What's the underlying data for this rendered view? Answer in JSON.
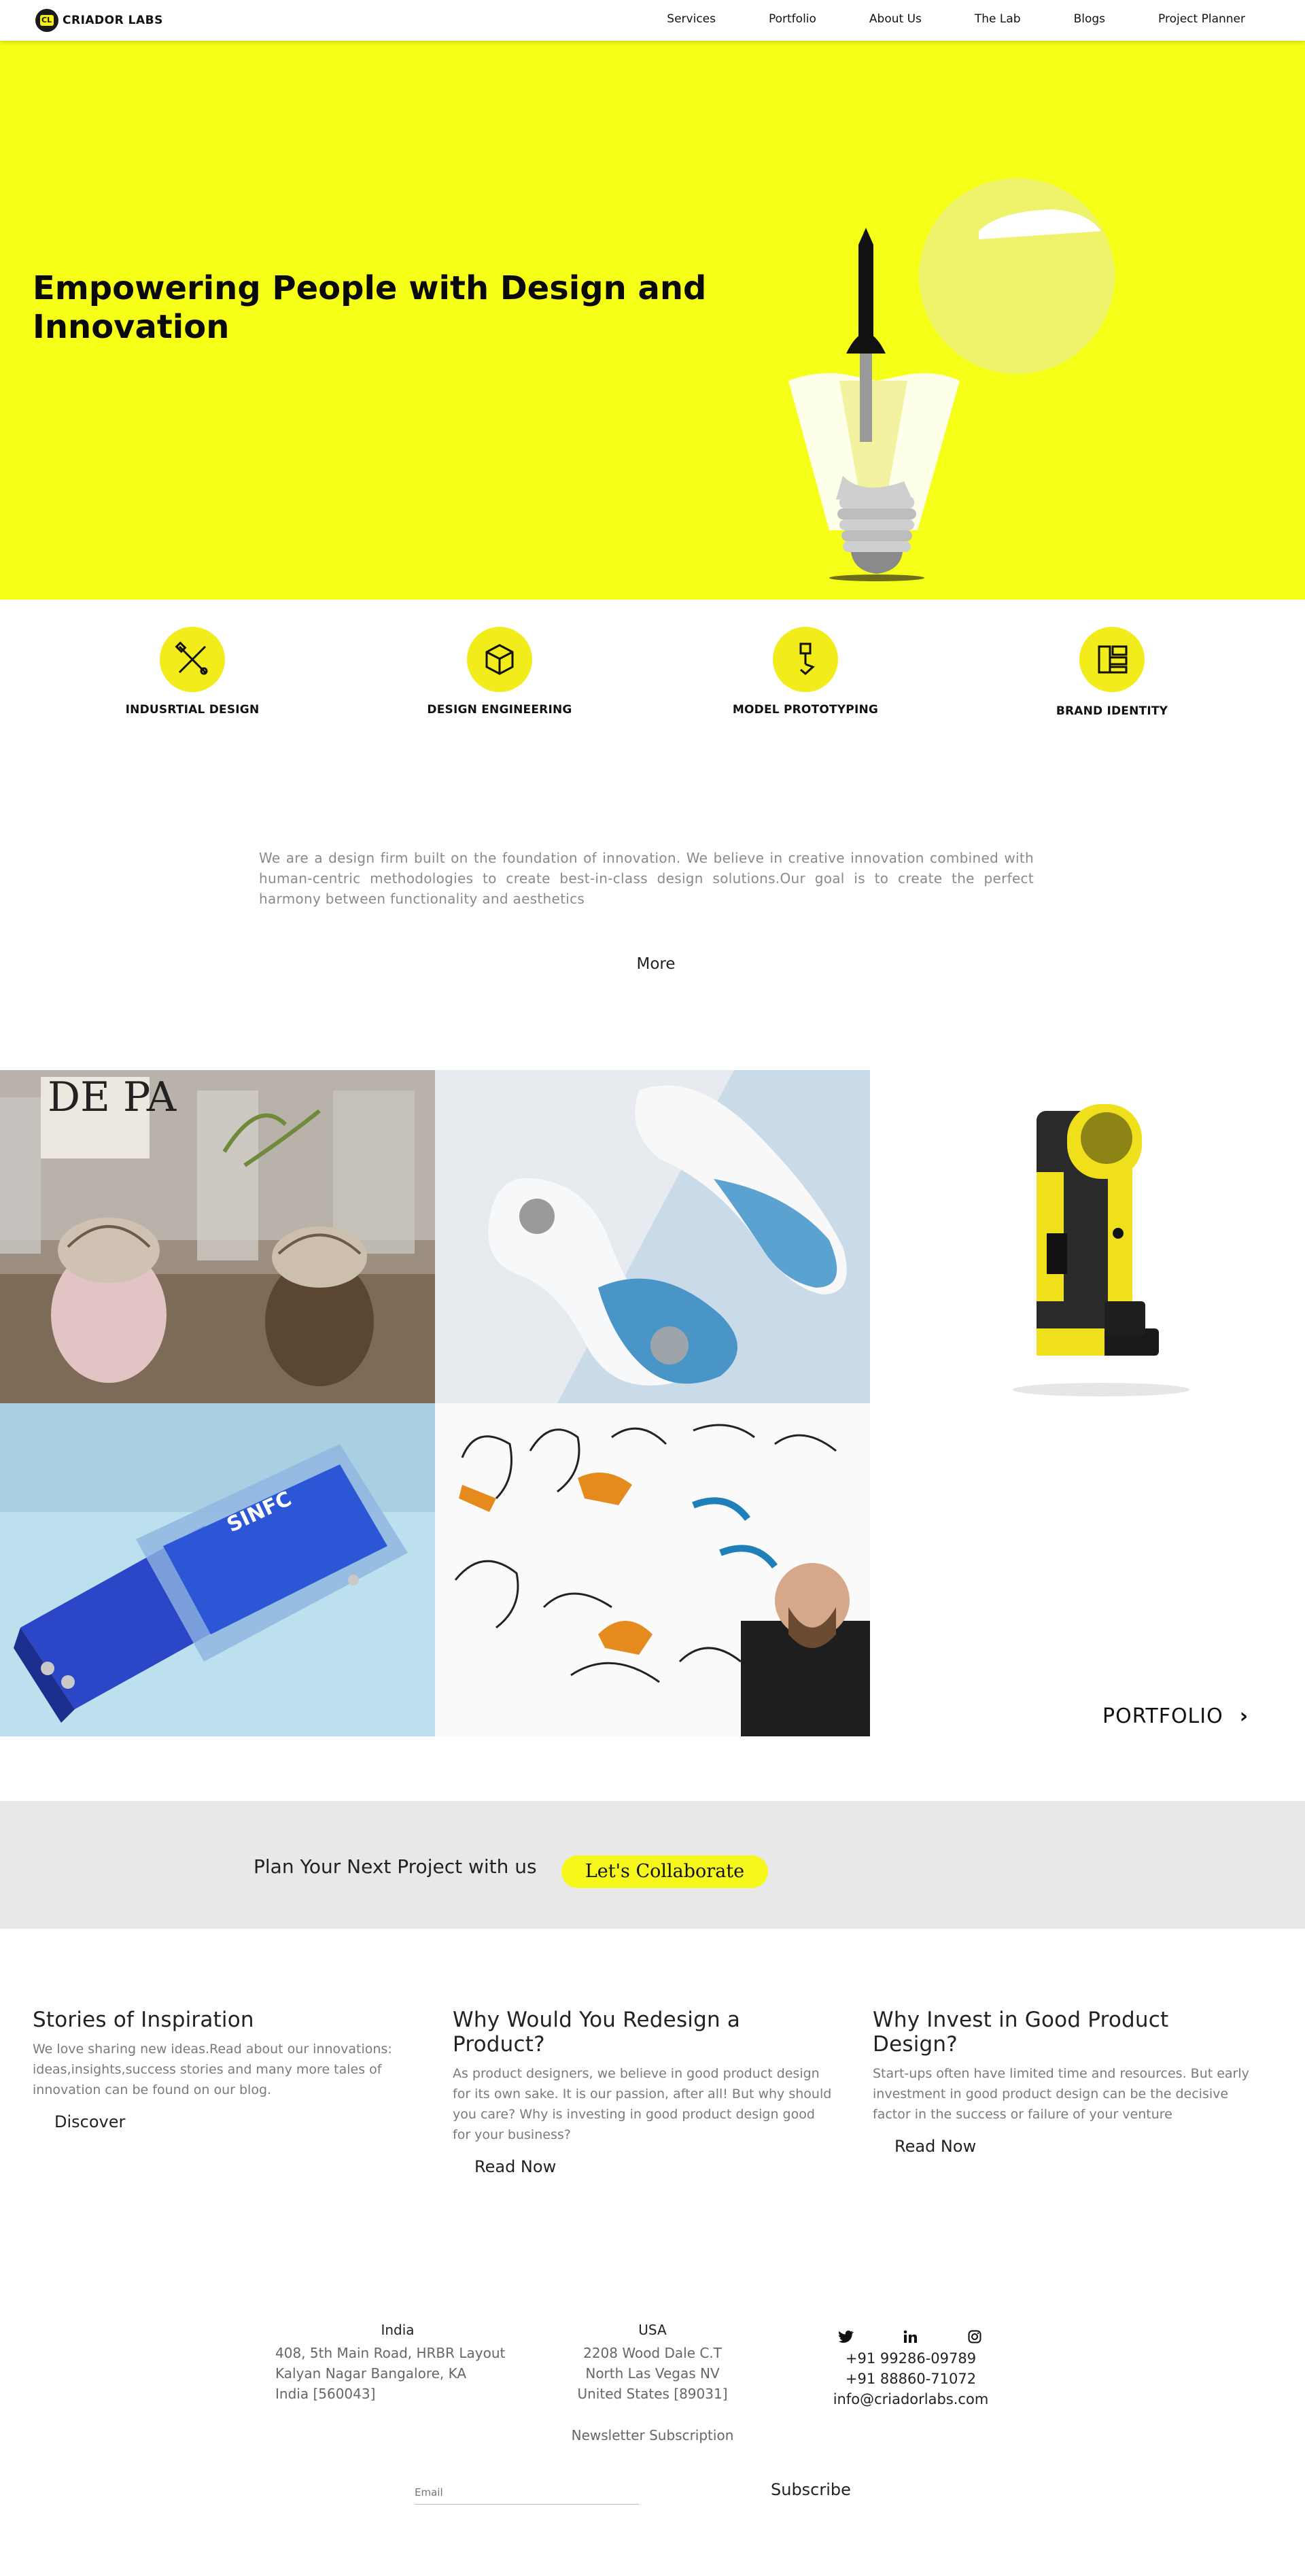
{
  "header": {
    "logo_mark": "CL",
    "logo_text": "CRIADOR LABS",
    "nav": [
      "Services",
      "Portfolio",
      "About Us",
      "The Lab",
      "Blogs",
      "Project Planner"
    ]
  },
  "hero": {
    "title": "Empowering People with Design and Innovation",
    "illustration_icon": "lightbulb-pencil-icon"
  },
  "services": [
    {
      "label": "INDUSRTIAL DESIGN",
      "icon": "tools-icon"
    },
    {
      "label": "DESIGN ENGINEERING",
      "icon": "cube-icon"
    },
    {
      "label": "MODEL PROTOTYPING",
      "icon": "prototype-icon"
    },
    {
      "label": "BRAND IDENTITY",
      "icon": "brand-icon"
    }
  ],
  "about": {
    "text": "We are a design firm built on the foundation of innovation. We believe in creative innovation combined with human-centric methodologies to create best-in-class design solutions.Our goal is to create the perfect harmony between functionality and aesthetics",
    "more_label": "More"
  },
  "gallery": {
    "items": [
      "salt-pepper-shakers-photo",
      "blue-wearable-device-photo",
      "yellow-handheld-device-photo",
      "blue-usb-device-photo",
      "headphone-sketches-photo"
    ],
    "portfolio_label": "PORTFOLIO"
  },
  "collab": {
    "text": "Plan Your Next Project with us",
    "button_label": "Let's Collaborate"
  },
  "blogs": [
    {
      "title": "Stories of Inspiration",
      "body": "We love sharing new ideas.Read about our innovations: ideas,insights,success stories and many more tales of innovation can be found on our blog.",
      "cta": "Discover"
    },
    {
      "title": "Why Would You Redesign a Product?",
      "body": "As product designers, we believe in good product design for its own sake. It is our passion, after all! But why should you care? Why is investing in good product design good for your business?",
      "cta": "Read Now"
    },
    {
      "title": "Why Invest in Good Product Design?",
      "body": "Start-ups often have limited time and resources. But early investment in good product design can be the decisive factor in the success or failure of your venture",
      "cta": "Read Now"
    }
  ],
  "footer": {
    "india": {
      "title": "India",
      "lines": [
        "408, 5th Main Road, HRBR Layout",
        "Kalyan Nagar Bangalore, KA",
        "India [560043]"
      ]
    },
    "usa": {
      "title": "USA",
      "lines": [
        "2208 Wood Dale C.T",
        "North Las Vegas NV",
        "United States [89031]"
      ]
    },
    "social": [
      "twitter-icon",
      "linkedin-icon",
      "instagram-icon"
    ],
    "contact": [
      "+91 99286-09789",
      "+91 88860-71072",
      "info@criadorlabs.com"
    ],
    "newsletter_label": "Newsletter Subscription",
    "email_placeholder": "Email",
    "subscribe_label": "Subscribe"
  },
  "colors": {
    "accent": "#f6ff17",
    "circle": "#f2ec1a",
    "band": "#e8e8e8"
  }
}
